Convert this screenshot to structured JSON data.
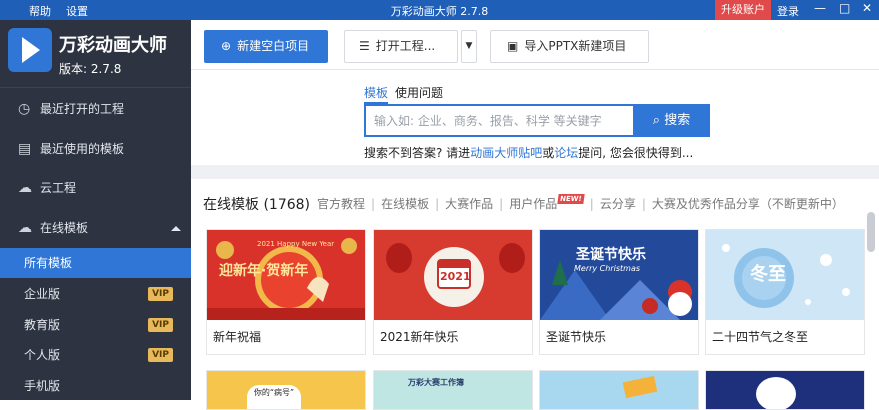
{
  "titlebar": {
    "help": "帮助",
    "settings": "设置",
    "title": "万彩动画大师 2.7.8",
    "upgrade": "升级账户",
    "login": "登录",
    "minimize": "—",
    "maximize": "□",
    "close": "✕"
  },
  "sidebar": {
    "app_name": "万彩动画大师",
    "version": "版本: 2.7.8",
    "items": [
      {
        "label": "最近打开的工程",
        "icon": "clock-icon"
      },
      {
        "label": "最近使用的模板",
        "icon": "template-icon"
      },
      {
        "label": "云工程",
        "icon": "cloud-icon"
      },
      {
        "label": "在线模板",
        "icon": "cloud-icon"
      }
    ],
    "sub_items": [
      {
        "label": "所有模板",
        "vip": ""
      },
      {
        "label": "企业版",
        "vip": "VIP"
      },
      {
        "label": "教育版",
        "vip": "VIP"
      },
      {
        "label": "个人版",
        "vip": "VIP"
      },
      {
        "label": "手机版",
        "vip": ""
      }
    ]
  },
  "toolbar": {
    "new_blank": "新建空白项目",
    "open_project": "打开工程...",
    "import_pptx": "导入PPTX新建项目"
  },
  "search": {
    "tab_templates": "模板",
    "tab_questions": "使用问题",
    "placeholder": "输入如: 企业、商务、报告、科学 等关键字",
    "button": "搜索",
    "hint_prefix": "搜索不到答案? 请进",
    "hint_link1": "动画大师贴吧",
    "hint_or": "或",
    "hint_link2": "论坛",
    "hint_suffix": "提问, 您会很快得到..."
  },
  "templates": {
    "title": "在线模板 (1768)",
    "filters": [
      "官方教程",
      "在线模板",
      "大赛作品",
      "用户作品",
      "云分享",
      "大赛及优秀作品分享（不断更新中）"
    ],
    "new_badge": "NEW!",
    "cards": [
      {
        "label": "新年祝福",
        "thumb_text": "迎新年·贺新年",
        "sub_text": "2021 Happy New Year"
      },
      {
        "label": "2021新年快乐",
        "thumb_text": "2021"
      },
      {
        "label": "圣诞节快乐",
        "thumb_text": "圣诞节快乐",
        "sub_text": "Merry Christmas"
      },
      {
        "label": "二十四节气之冬至",
        "thumb_text": "冬至"
      }
    ],
    "row2_texts": [
      "你的“病号”",
      "万彩大赛工作簿",
      "",
      ""
    ]
  },
  "colors": {
    "accent": "#2f76d6",
    "sidebar_bg": "#2d3340",
    "titlebar_bg": "#1f5fb8",
    "upgrade_bg": "#e14a4a",
    "vip_bg": "#e7b95a"
  }
}
